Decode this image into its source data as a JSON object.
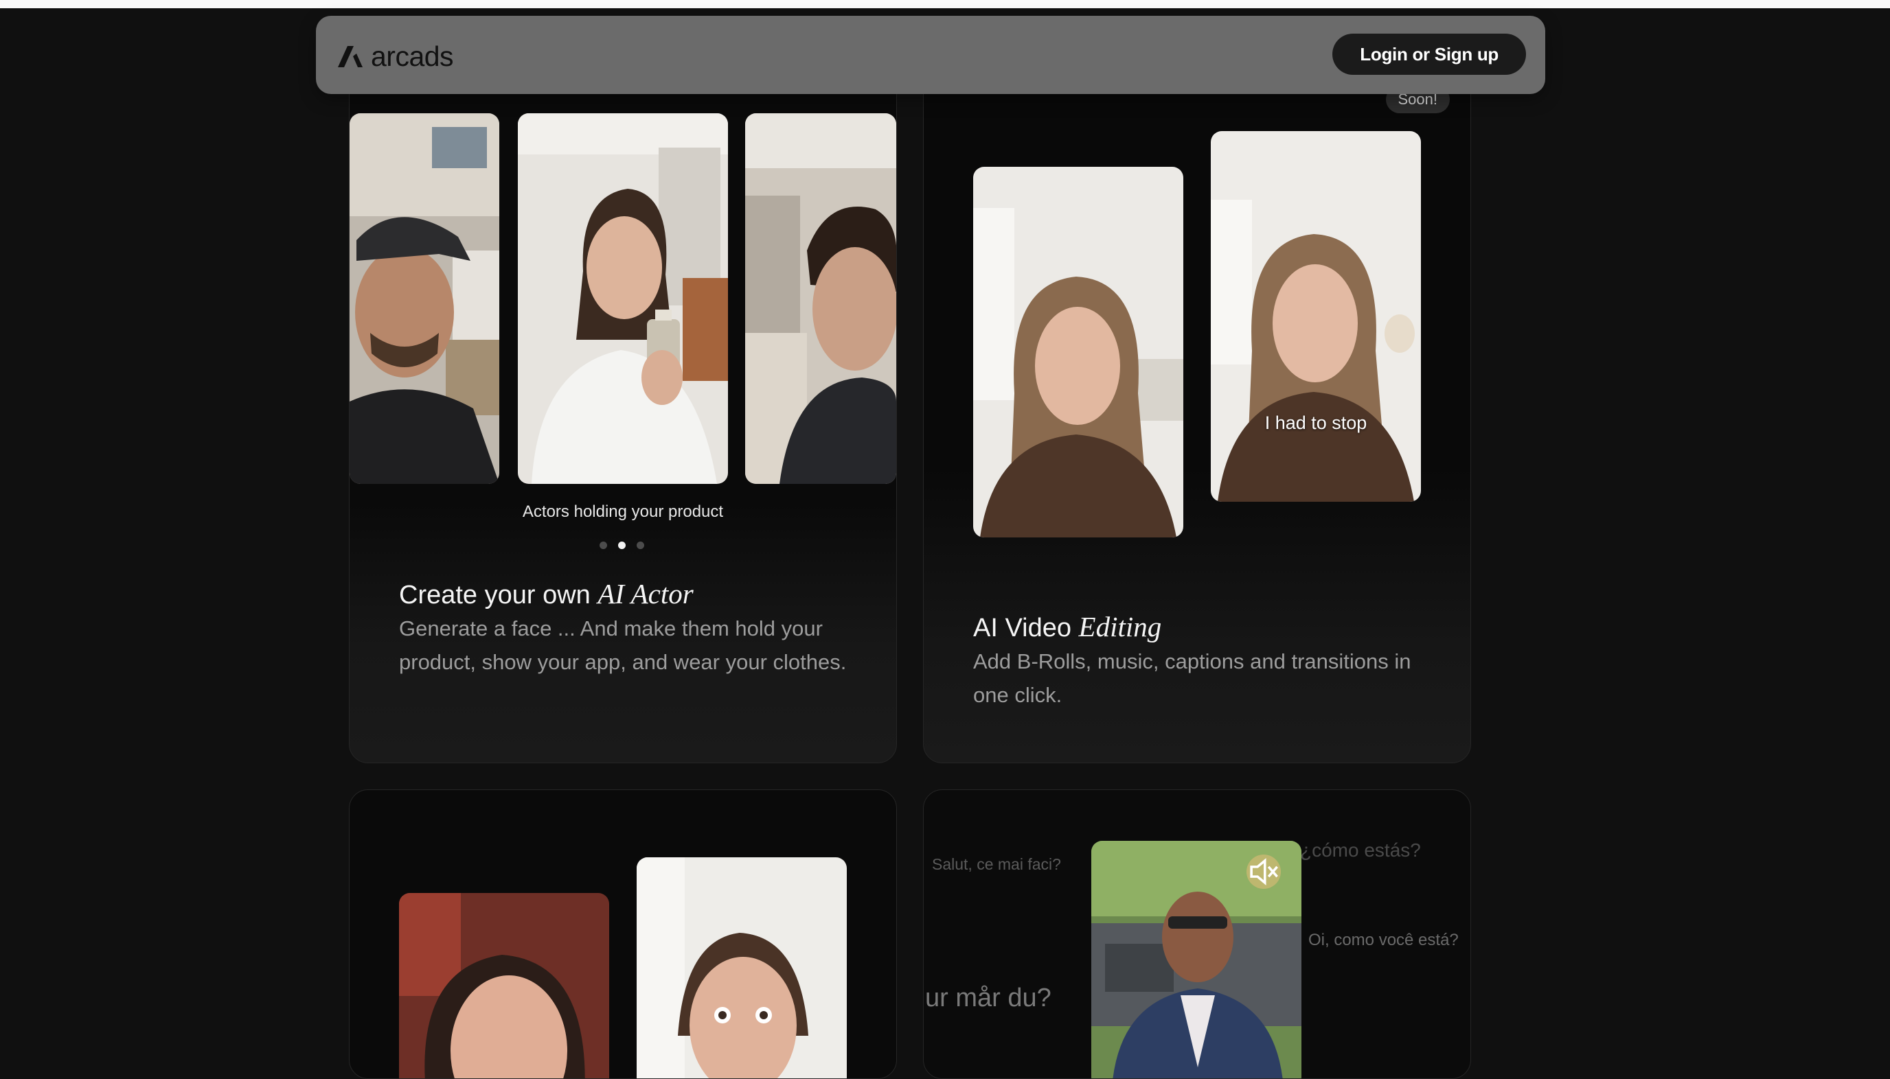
{
  "navbar": {
    "brand": "arcads",
    "login_label": "Login or Sign up"
  },
  "cards": {
    "ai_actor": {
      "carousel_caption": "Actors holding your product",
      "title_plain": "Create your own ",
      "title_emphasis": "AI Actor",
      "description": "Generate a face ... And make them hold your product, show your app, and wear your clothes.",
      "carousel_total": 3,
      "carousel_active_index": 1
    },
    "ai_video_editing": {
      "badge": "Soon!",
      "subtitle_overlay": "I had to stop",
      "title_plain": "AI Video ",
      "title_emphasis": "Editing",
      "description": "Add B-Rolls, music, captions and transitions in one click."
    },
    "translation": {
      "phrases": [
        "Salut, ce mai faci?",
        "¿cómo estás?",
        "Oi, como você está?",
        "ur mår du?"
      ]
    }
  },
  "colors": {
    "background": "#101010",
    "card": "#191919",
    "navbar": "#6b6b6b",
    "button": "#1b1b1b",
    "muted_text": "#9d9d9d"
  }
}
